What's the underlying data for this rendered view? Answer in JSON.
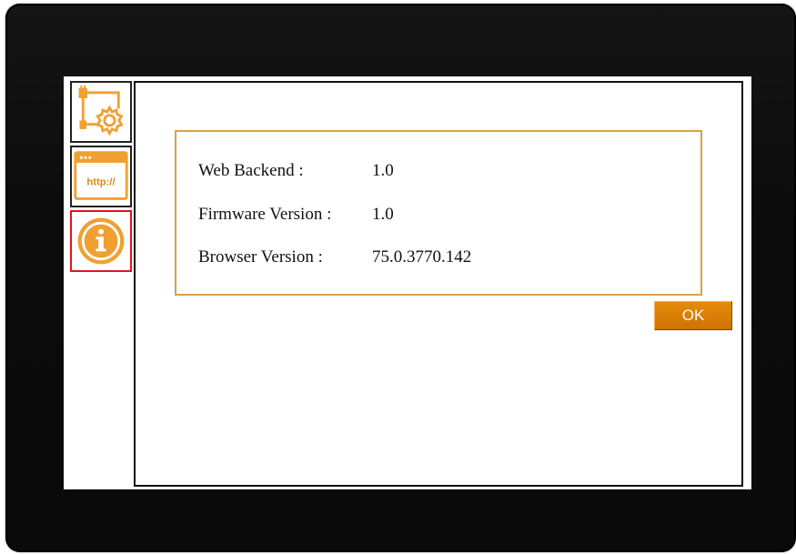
{
  "sidebar": {
    "items": [
      {
        "name": "network-settings",
        "icon": "network-settings-icon",
        "active": false
      },
      {
        "name": "web-url",
        "icon": "http-browser-icon",
        "label": "http://",
        "active": false
      },
      {
        "name": "information",
        "icon": "info-icon",
        "label": "i",
        "active": true
      }
    ]
  },
  "about": {
    "rows": [
      {
        "label": "Web Backend :",
        "value": "1.0"
      },
      {
        "label": "Firmware Version :",
        "value": "1.0"
      },
      {
        "label": "Browser Version :",
        "value": "75.0.3770.142"
      }
    ],
    "ok_label": "OK"
  },
  "colors": {
    "accent_orange": "#f0a030",
    "button_orange": "#d97a06",
    "box_border": "#d9a24a",
    "active_border": "#e0141e",
    "bezel": "#0f0f0f"
  }
}
